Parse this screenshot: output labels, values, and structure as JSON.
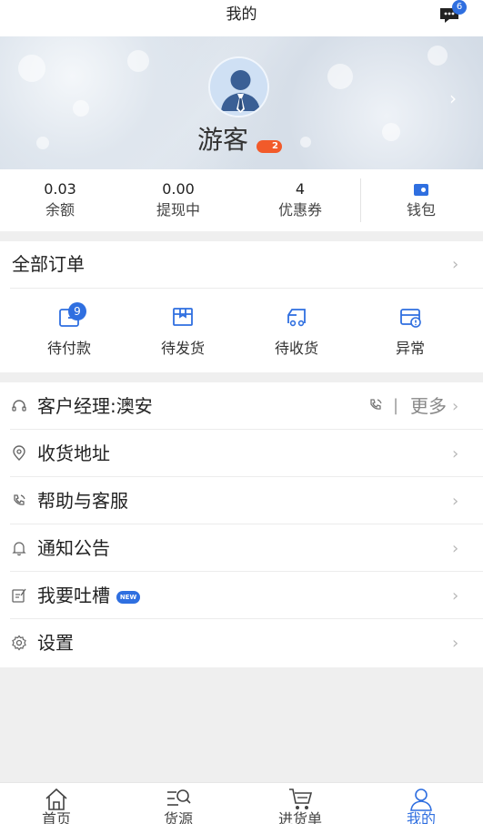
{
  "header": {
    "title": "我的",
    "message_badge": "6"
  },
  "profile": {
    "name": "游客",
    "level": "2"
  },
  "stats": [
    {
      "value": "0.03",
      "label": "余额"
    },
    {
      "value": "0.00",
      "label": "提现中"
    },
    {
      "value": "4",
      "label": "优惠券"
    },
    {
      "label": "钱包"
    }
  ],
  "orders": {
    "title": "全部订单",
    "items": [
      {
        "label": "待付款",
        "badge": "9"
      },
      {
        "label": "待发货"
      },
      {
        "label": "待收货"
      },
      {
        "label": "异常"
      }
    ]
  },
  "menu": {
    "manager": "客户经理:澳安",
    "more": "更多",
    "pipe": "|",
    "address": "收货地址",
    "help": "帮助与客服",
    "notice": "通知公告",
    "feedback": "我要吐槽",
    "new_badge": "NEW",
    "settings": "设置"
  },
  "tabbar": [
    {
      "label": "首页"
    },
    {
      "label": "货源"
    },
    {
      "label": "进货单"
    },
    {
      "label": "我的",
      "active": true
    }
  ],
  "colors": {
    "accent": "#2f6fe0",
    "level_badge": "#f25a2a"
  }
}
